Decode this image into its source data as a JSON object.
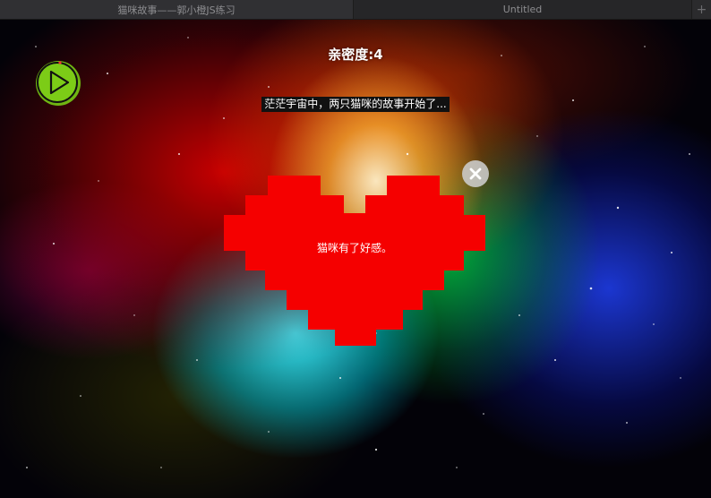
{
  "tabs": [
    {
      "label": "猫咪故事——郭小橙JS练习",
      "active": true
    },
    {
      "label": "Untitled",
      "active": false
    }
  ],
  "new_tab_label": "+",
  "game": {
    "intimacy_label": "亲密度:",
    "intimacy_value": "4",
    "story_caption": "茫茫宇宙中，两只猫咪的故事开始了...",
    "heart_message": "猫咪有了好感。",
    "play_button_icon": "play-icon",
    "close_button_icon": "close-icon"
  },
  "colors": {
    "heart": "#f50000",
    "play_button": "#7ccc17",
    "close_button_bg": "#cdcdcd"
  }
}
